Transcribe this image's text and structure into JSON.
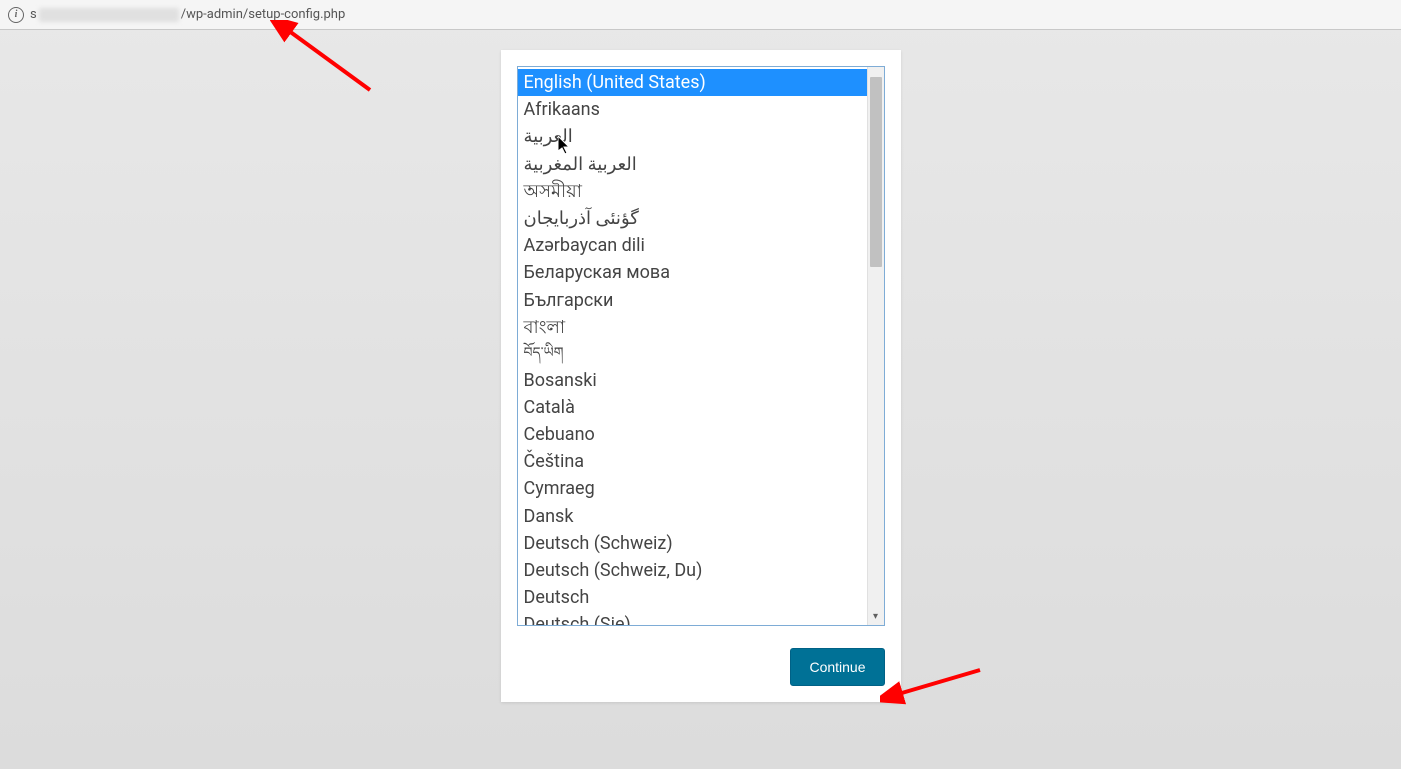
{
  "address_bar": {
    "prefix": "s",
    "suffix": "/wp-admin/setup-config.php"
  },
  "languages": [
    {
      "label": "English (United States)",
      "selected": true
    },
    {
      "label": "Afrikaans"
    },
    {
      "label": "العربية",
      "rtl": true
    },
    {
      "label": "العربية المغربية",
      "rtl": true
    },
    {
      "label": "অসমীয়া"
    },
    {
      "label": "گؤنئی آذربایجان",
      "rtl": true
    },
    {
      "label": "Azərbaycan dili"
    },
    {
      "label": "Беларуская мова"
    },
    {
      "label": "Български"
    },
    {
      "label": "বাংলা"
    },
    {
      "label": "བོད་ཡིག",
      "small": true
    },
    {
      "label": "Bosanski"
    },
    {
      "label": "Català"
    },
    {
      "label": "Cebuano"
    },
    {
      "label": "Čeština"
    },
    {
      "label": "Cymraeg"
    },
    {
      "label": "Dansk"
    },
    {
      "label": "Deutsch (Schweiz)"
    },
    {
      "label": "Deutsch (Schweiz, Du)"
    },
    {
      "label": "Deutsch"
    },
    {
      "label": "Deutsch (Sie)"
    }
  ],
  "button": {
    "continue_label": "Continue"
  }
}
